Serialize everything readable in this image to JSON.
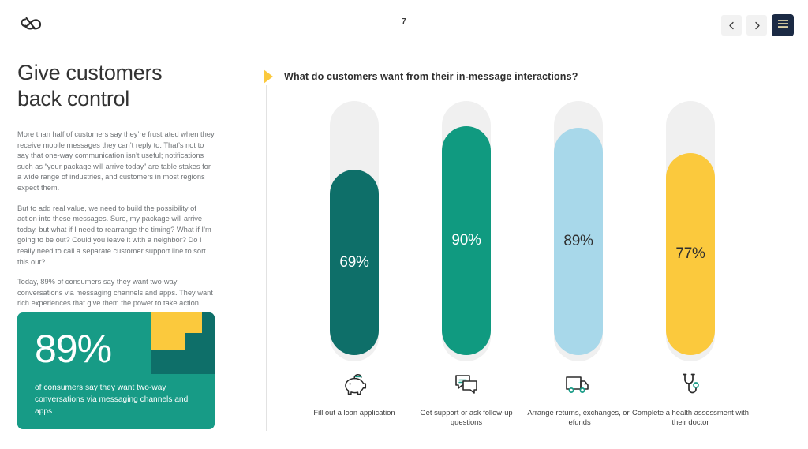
{
  "topbar": {
    "logo_icon": "infinity-loop-logo",
    "page_number": "7",
    "prev_icon": "chevron-left-icon",
    "next_icon": "chevron-right-icon",
    "menu_icon": "hamburger-menu-icon"
  },
  "left": {
    "headline_line1": "Give customers",
    "headline_line2": "back control",
    "paragraphs": [
      "More than half of customers say they’re frustrated when they receive mobile messages they can’t reply to. That’s not to say that one-way communication isn’t useful; notifications such as “your package will arrive today” are table stakes for a wide range of industries, and customers in most regions expect them.",
      "But to add real value, we need to build the possibility of action into these messages. Sure, my package will arrive today, but what if I need to rearrange the timing? What if I’m going to be out? Could you leave it with a neighbor? Do I really need to call a separate customer support line to sort this out?",
      "Today, 89% of consumers say they want two-way conversations via messaging channels and apps. They want rich experiences that give them the power to take action."
    ],
    "stat_card": {
      "number": "89%",
      "caption": "of consumers say they want two-way conversations via messaging channels and apps",
      "bg_color": "#179b86",
      "accent_dark": "#0e6f69",
      "accent_yellow": "#fbc93d"
    }
  },
  "chart_data": {
    "type": "bar",
    "title": "What do customers want from their in-message interactions?",
    "xlabel": "",
    "ylabel": "",
    "ylim": [
      0,
      100
    ],
    "grid": false,
    "legend": "none",
    "orientation": "vertical",
    "categories": [
      "Fill out a loan application",
      "Get support or ask follow-up questions",
      "Arrange returns, exchanges, or refunds",
      "Complete a health assessment with their doctor"
    ],
    "values": [
      69,
      90,
      89,
      77
    ],
    "value_labels": [
      "69%",
      "90%",
      "89%",
      "77%"
    ],
    "bar_colors": [
      "#0e6f69",
      "#109a80",
      "#a8d8ea",
      "#fbc93d"
    ],
    "label_text_colors": [
      "#ffffff",
      "#ffffff",
      "#2f2f2f",
      "#2f2f2f"
    ],
    "track_color": "#f0f0f0",
    "icons": [
      "piggy-bank-icon",
      "chat-bubbles-icon",
      "delivery-truck-icon",
      "stethoscope-icon"
    ]
  }
}
